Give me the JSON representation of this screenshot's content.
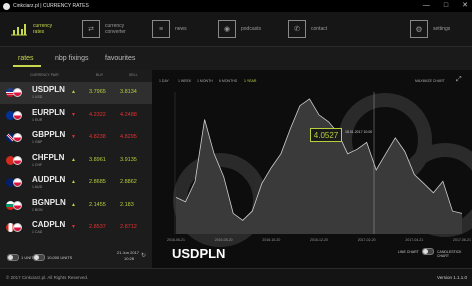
{
  "titlebar": {
    "title": "Cinkciarz.pl | CURRENCY RATES"
  },
  "nav": {
    "items": [
      {
        "label": "currency rates",
        "icon": "bar-chart-icon"
      },
      {
        "label": "currency converter",
        "icon": "converter-icon"
      },
      {
        "label": "news",
        "icon": "newspaper-icon"
      },
      {
        "label": "podcasts",
        "icon": "podcast-icon"
      },
      {
        "label": "contact",
        "icon": "phone-icon"
      },
      {
        "label": "settings",
        "icon": "gear-icon"
      }
    ]
  },
  "subtabs": [
    "rates",
    "nbp fixings",
    "favourites"
  ],
  "table": {
    "headers": {
      "pair": "CURRENCY PAIR",
      "buy": "BUY",
      "sell": "SELL"
    },
    "rows": [
      {
        "pair": "USDPLN",
        "unit": "1 USD",
        "dir": "up",
        "buy": "3.7965",
        "sell": "3.8134",
        "flag1": "us",
        "flag2": "pl"
      },
      {
        "pair": "EURPLN",
        "unit": "1 EUR",
        "dir": "down",
        "buy": "4.2322",
        "sell": "4.2488",
        "flag1": "eu",
        "flag2": "pl"
      },
      {
        "pair": "GBPPLN",
        "unit": "1 GBP",
        "dir": "down",
        "buy": "4.8238",
        "sell": "4.8295",
        "flag1": "gb",
        "flag2": "pl"
      },
      {
        "pair": "CHFPLN",
        "unit": "1 CHF",
        "dir": "up",
        "buy": "3.8961",
        "sell": "3.9135",
        "flag1": "ch",
        "flag2": "pl"
      },
      {
        "pair": "AUDPLN",
        "unit": "1 AUD",
        "dir": "up",
        "buy": "2.8685",
        "sell": "2.8862",
        "flag1": "au",
        "flag2": "pl"
      },
      {
        "pair": "BGNPLN",
        "unit": "1 BGN",
        "dir": "up",
        "buy": "2.1455",
        "sell": "2.183",
        "flag1": "bg",
        "flag2": "pl"
      },
      {
        "pair": "CADPLN",
        "unit": "1 CAD",
        "dir": "down",
        "buy": "2.8537",
        "sell": "2.8712",
        "flag1": "ca",
        "flag2": "pl"
      }
    ]
  },
  "left_footer": {
    "unit_label": "1 UNIT",
    "units_label": "10,000 UNITS",
    "date": "21 Jun 2017",
    "time": "10:28"
  },
  "chart": {
    "ranges": [
      "1 DAY",
      "1 WEEK",
      "1 MONTH",
      "6 MONTHS",
      "1 YEAR"
    ],
    "active_range": "1 YEAR",
    "maximize": "MAXIMIZE CHART",
    "tooltip_value": "4.0527",
    "tooltip_date": "18.01.2017 10:00",
    "x_ticks": [
      "2016-06-21",
      "2016-08-20",
      "2016-10-20",
      "2016-12-20",
      "2017-02-20",
      "2017-04-21",
      "2017-06-21"
    ],
    "pair_title": "USDPLN",
    "line_chart": "LINE CHART",
    "candle_chart": "CANDLESTICK CHART"
  },
  "chart_data": {
    "type": "area",
    "title": "USDPLN",
    "xlabel": "",
    "ylabel": "",
    "x": [
      "2016-06-21",
      "2016-08-20",
      "2016-10-20",
      "2016-12-20",
      "2017-02-20",
      "2017-04-21",
      "2017-06-21"
    ],
    "series": [
      {
        "name": "USDPLN",
        "values": [
          3.86,
          3.84,
          3.93,
          4.2,
          4.05,
          3.95,
          3.79,
          3.76,
          3.8,
          3.92,
          3.99,
          4.05,
          4.16,
          4.26,
          4.29,
          4.22,
          4.19,
          4.14,
          4.05,
          4.07,
          4.1,
          3.98,
          4.05,
          4.12,
          4.06,
          3.96,
          3.92,
          3.88,
          3.93,
          3.8,
          3.79
        ]
      }
    ],
    "ylim": [
      3.7,
      4.32
    ],
    "grid": false
  },
  "statusbar": {
    "copyright": "© 2017 Cinkciarz.pl. All Rights Reserved.",
    "version": "Version 1.1.1.0"
  }
}
